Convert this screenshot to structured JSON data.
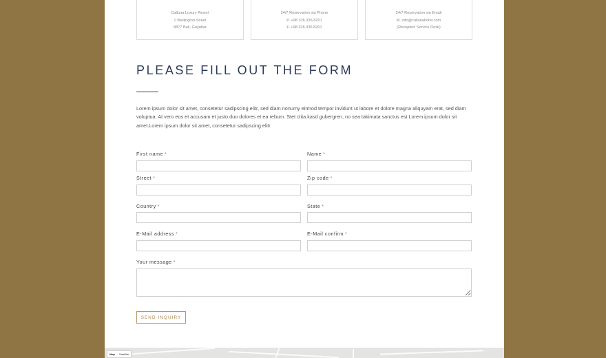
{
  "contact_cards": [
    {
      "lines": [
        "Calluna Luxury Resort",
        "1 Wellington Street",
        "8877 Bali, Gnyahar"
      ]
    },
    {
      "lines": [
        "24/7 Reservation via Phone",
        "P. +98 326.336.8201",
        "F. +98 326.336.8201"
      ]
    },
    {
      "lines": [
        "24/7 Reservation via Email",
        "M. info@callunahotel.com",
        "(Reception Service Desk)"
      ]
    }
  ],
  "form": {
    "title": "PLEASE FILL OUT THE FORM",
    "intro": "Lorem ipsum dolor sit amet, consetetur sadipscing elitr, sed diam nonumy eirmod tempor invidunt ut labore et dolore magna aliquyam erat, sed diam voluptua. At vero eos et accusam et justo duo dolores et ea rebum. Stet clita kasd gubergren, no sea takimata sanctus est Lorem ipsum dolor sit amet.Lorem ipsum dolor sit amet, consetetur sadipscing elitr",
    "required_mark": "*",
    "fields": {
      "first_name": {
        "label": "First name",
        "value": ""
      },
      "name": {
        "label": "Name",
        "value": ""
      },
      "street": {
        "label": "Street",
        "value": ""
      },
      "zip_code": {
        "label": "Zip code",
        "value": ""
      },
      "country": {
        "label": "Country",
        "value": ""
      },
      "state": {
        "label": "State",
        "value": ""
      },
      "email": {
        "label": "E-Mail address",
        "value": ""
      },
      "email_confirm": {
        "label": "E-Mail confirm",
        "value": ""
      },
      "message": {
        "label": "Your message",
        "value": ""
      }
    },
    "submit_label": "SEND INQUIRY"
  },
  "map": {
    "toggle_map": "Map",
    "toggle_satellite": "Satellite"
  },
  "colors": {
    "background": "#8f7544",
    "title": "#2b3a5c",
    "accent": "#a8834a"
  }
}
